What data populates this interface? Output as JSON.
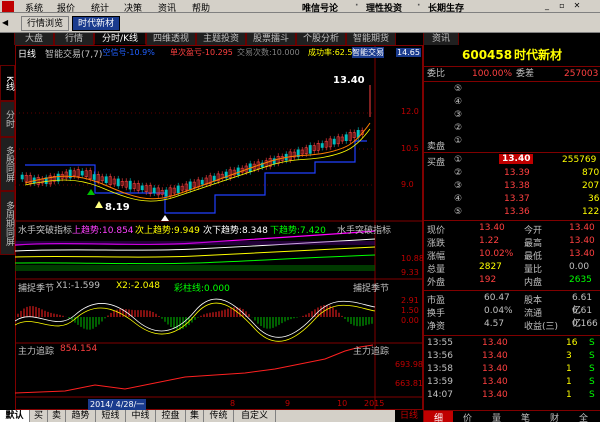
{
  "menu": {
    "items": [
      "系统",
      "报价",
      "统计",
      "决策",
      "资讯",
      "帮助"
    ],
    "slogan": [
      "唯信号论",
      "理性投资",
      "长期生存"
    ]
  },
  "tabs": {
    "items": [
      "行情浏览",
      "时代新材"
    ]
  },
  "func_tabs": [
    "大盘",
    "行情",
    "分时/K线",
    "四维透视",
    "主题投资",
    "股票擂斗",
    "个股分析",
    "智能期货",
    "资讯"
  ],
  "vtabs": [
    "K线",
    "分时",
    "多股同屏",
    "多周期同屏"
  ],
  "kline": {
    "title": "日线",
    "ind_name": "智能交易(7,7)",
    "ind_vals": [
      "·空信号-10.9%",
      "单次盈亏-10.295",
      "交易次数:10.000",
      "成功率:62.5%",
      "智能交易"
    ],
    "price_axis": [
      "14.65",
      "12.0",
      "10.5",
      "9.0"
    ],
    "high_label": "13.40",
    "low_label": "8.19"
  },
  "ind1": {
    "title": "水手突破指标",
    "up": "上趋势:10.854",
    "mid_up": "次上趋势:9.949",
    "mid_down": "次下趋势:8.348",
    "down": "下趋势:7.420",
    "right_title": "水手突破指标",
    "axis": [
      "10.88",
      "9.33"
    ]
  },
  "ind2": {
    "title": "捕捉季节",
    "x1": "X1:-1.599",
    "x2": "X2:-2.048",
    "zhu": "彩柱线:0.000",
    "right_title": "捕捉季节",
    "axis": [
      "2.91",
      "1.50",
      "0.00"
    ]
  },
  "ind3": {
    "title": "主力追踪",
    "val": "854.154",
    "right_title": "主力追踪",
    "axis": [
      "693.98",
      "663.81"
    ]
  },
  "date_axis": {
    "current": "2014/ 4/28/一",
    "labels": [
      "8",
      "9",
      "10",
      "2015"
    ]
  },
  "quote": {
    "code": "600458",
    "name": "时代新材",
    "weibi_label": "委比",
    "weibi": "100.00%",
    "weicha_label": "委差",
    "weicha": "257003",
    "sell": [
      {
        "n": "⑤"
      },
      {
        "n": "④"
      },
      {
        "n": "③"
      },
      {
        "n": "②"
      },
      {
        "n": "①"
      }
    ],
    "sell_label": "卖盘",
    "buy_label": "买盘",
    "buy": [
      {
        "n": "①",
        "p": "13.40",
        "v": "255769"
      },
      {
        "n": "②",
        "p": "13.39",
        "v": "870"
      },
      {
        "n": "③",
        "p": "13.38",
        "v": "207"
      },
      {
        "n": "④",
        "p": "13.37",
        "v": "36"
      },
      {
        "n": "⑤",
        "p": "13.36",
        "v": "122"
      }
    ],
    "stats": [
      {
        "l1": "现价",
        "v1": "13.40",
        "l2": "今开",
        "v2": "13.40"
      },
      {
        "l1": "涨跌",
        "v1": "1.22",
        "l2": "最高",
        "v2": "13.40"
      },
      {
        "l1": "涨幅",
        "v1": "10.02%",
        "l2": "最低",
        "v2": "13.40"
      },
      {
        "l1": "总量",
        "v1": "2827",
        "l2": "量比",
        "v2": "0.00"
      },
      {
        "l1": "外盘",
        "v1": "192",
        "l2": "内盘",
        "v2": "2635"
      }
    ],
    "fin": [
      {
        "l1": "市盈",
        "v1": "60.47",
        "l2": "股本",
        "v2": "6.61亿"
      },
      {
        "l1": "换手",
        "v1": "0.04%",
        "l2": "流通",
        "v2": "6.61亿"
      },
      {
        "l1": "净资",
        "v1": "4.57",
        "l2": "收益(三)",
        "v2": "0.166"
      }
    ],
    "ticks": [
      {
        "t": "13:55",
        "p": "13.40",
        "v": "16",
        "d": "S"
      },
      {
        "t": "13:56",
        "p": "13.40",
        "v": "3",
        "d": "S"
      },
      {
        "t": "13:58",
        "p": "13.40",
        "v": "1",
        "d": "S"
      },
      {
        "t": "13:59",
        "p": "13.40",
        "v": "1",
        "d": "S"
      },
      {
        "t": "14:07",
        "p": "13.40",
        "v": "1",
        "d": "S"
      }
    ],
    "tabs": [
      "细",
      "价",
      "量",
      "笔",
      "财",
      "全"
    ]
  },
  "bottom_tabs": [
    "默认",
    "买",
    "卖",
    "趋势",
    "短线",
    "中线",
    "控盘",
    "集",
    "传统",
    "自定义"
  ],
  "bottom_right": [
    "日线"
  ]
}
